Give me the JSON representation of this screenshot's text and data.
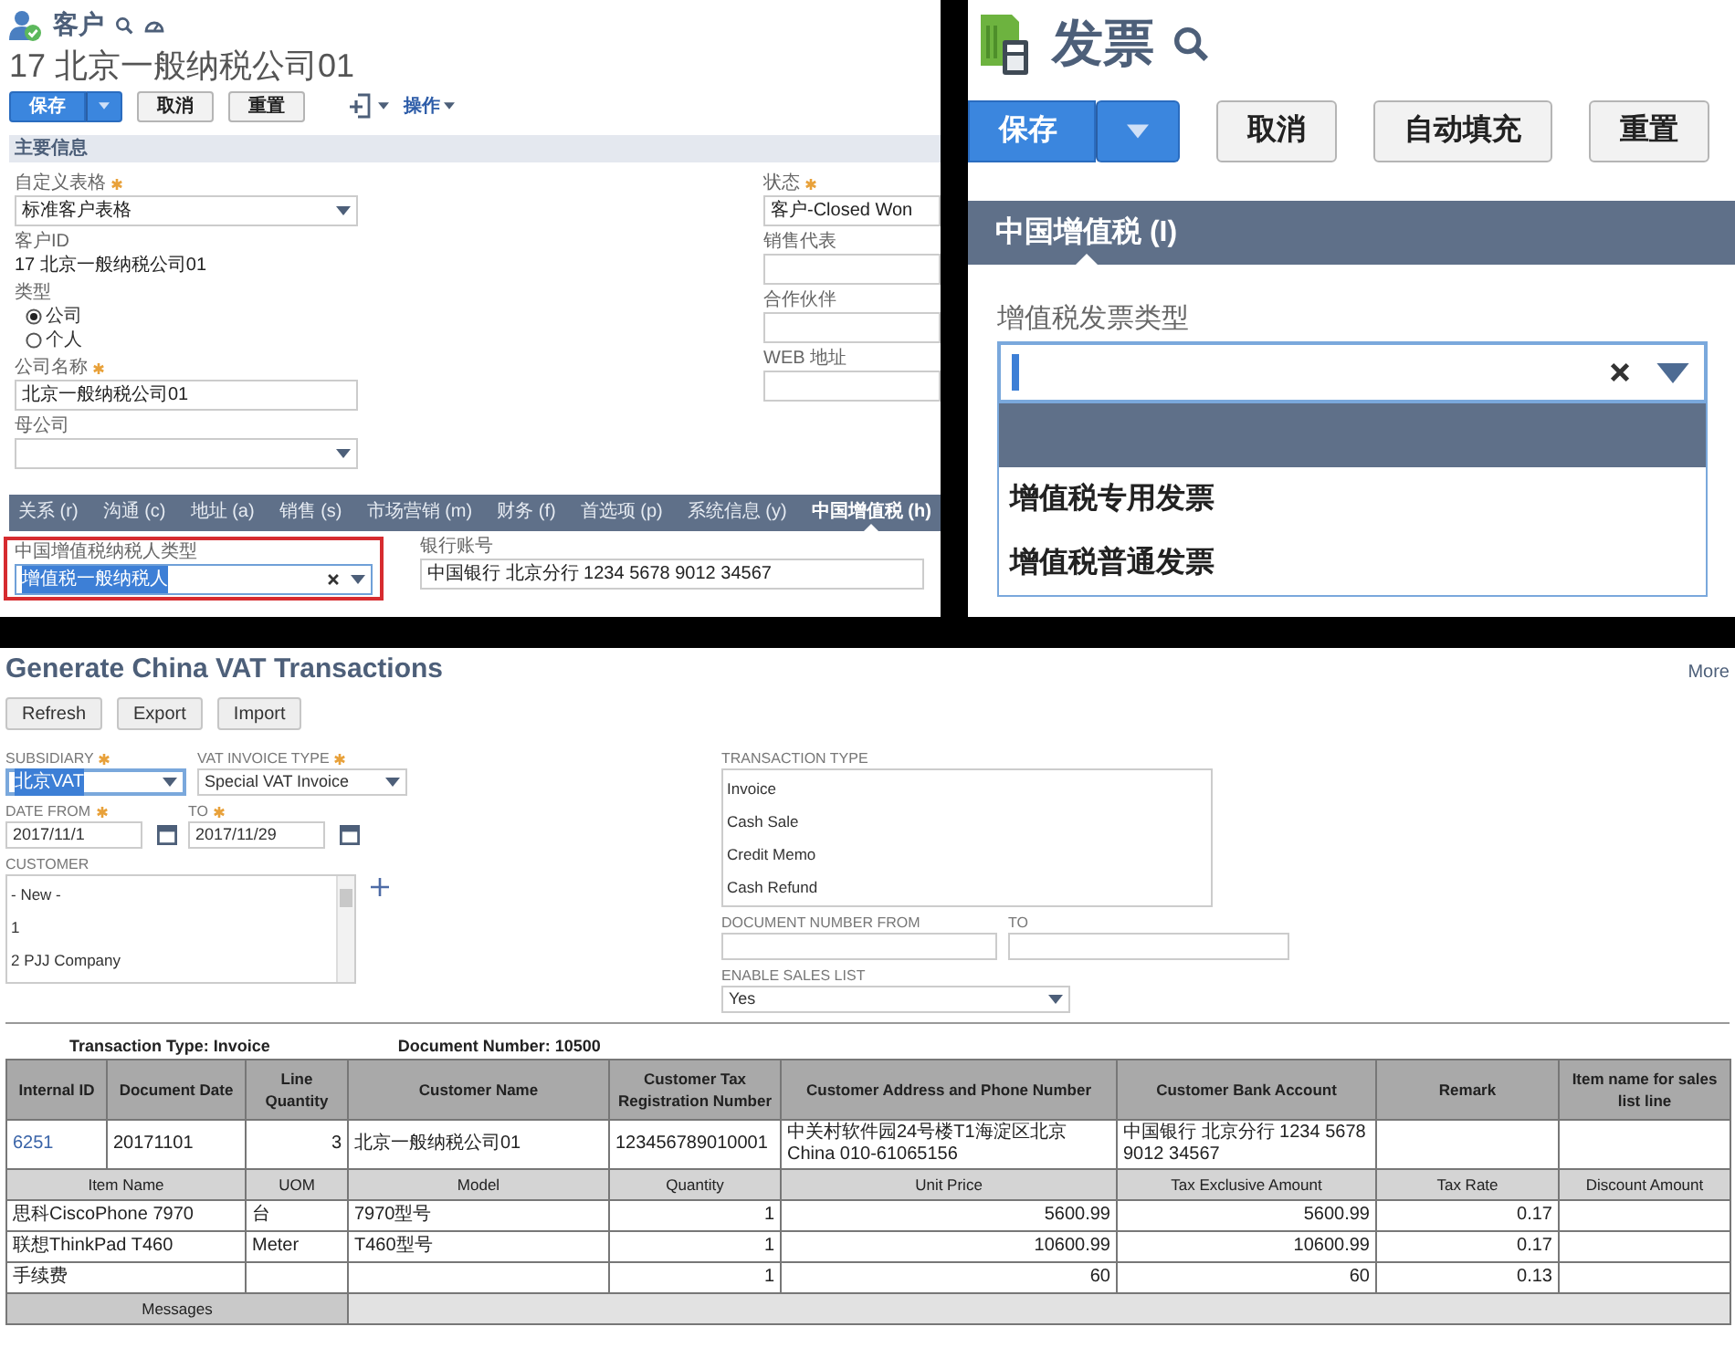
{
  "customer_form": {
    "title": "客户",
    "record_name": "17 北京一般纳税公司01",
    "buttons": [
      {
        "label": "保存",
        "kind": "split"
      },
      {
        "label": "取消",
        "kind": "plain"
      },
      {
        "label": "重置",
        "kind": "plain"
      }
    ],
    "actions_menu": "操作",
    "section": "主要信息",
    "left_fields": [
      {
        "kind": "select",
        "label": "自定义表格",
        "required": true,
        "value": "标准客户表格"
      },
      {
        "kind": "static",
        "label": "客户ID",
        "value": "17 北京一般纳税公司01"
      },
      {
        "kind": "radio",
        "label": "类型",
        "options": [
          {
            "label": "公司",
            "selected": true
          },
          {
            "label": "个人",
            "selected": false
          }
        ]
      },
      {
        "kind": "text",
        "label": "公司名称",
        "required": true,
        "value": "北京一般纳税公司01"
      },
      {
        "kind": "select",
        "label": "母公司"
      }
    ],
    "right_fields": [
      {
        "kind": "text",
        "label": "状态",
        "required": true,
        "value": "客户-Closed Won"
      },
      {
        "kind": "text",
        "label": "销售代表"
      },
      {
        "kind": "text",
        "label": "合作伙伴"
      },
      {
        "kind": "text",
        "label": "WEB 地址"
      }
    ],
    "tabs": [
      {
        "label": "关系 (r)",
        "selected": false
      },
      {
        "label": "沟通 (c)",
        "selected": false
      },
      {
        "label": "地址 (a)",
        "selected": false
      },
      {
        "label": "销售 (s)",
        "selected": false
      },
      {
        "label": "市场营销 (m)",
        "selected": false
      },
      {
        "label": "财务 (f)",
        "selected": false
      },
      {
        "label": "首选项 (p)",
        "selected": false
      },
      {
        "label": "系统信息 (y)",
        "selected": false
      },
      {
        "label": "中国增值税 (h)",
        "selected": true
      }
    ],
    "tab_fields": [
      {
        "kind": "combo",
        "label": "中国增值税纳税人类型",
        "value": "增值税一般纳税人",
        "focused": true,
        "highlighted": true
      },
      {
        "kind": "text",
        "label": "银行账号",
        "value": "中国银行 北京分行 1234 5678 9012 34567"
      }
    ]
  },
  "invoice_form": {
    "title": "发票",
    "buttons": [
      {
        "label": "保存",
        "kind": "split"
      },
      {
        "label": "取消",
        "kind": "plain"
      },
      {
        "label": "自动填充",
        "kind": "plain"
      },
      {
        "label": "重置",
        "kind": "plain"
      }
    ],
    "tabs": [
      {
        "label": "中国增值税 (I)",
        "selected": true
      }
    ],
    "field": {
      "label": "增值税发票类型",
      "expanded": true,
      "blank_option_highlighted": true,
      "options": [
        {
          "label": "增值税专用发票",
          "selected": false
        },
        {
          "label": "增值税普通发票",
          "selected": false
        }
      ]
    }
  },
  "vat_page": {
    "title": "Generate China VAT Transactions",
    "more_link": "More",
    "buttons": [
      "Refresh",
      "Export",
      "Import"
    ],
    "subsidiary": {
      "label": "SUBSIDIARY",
      "required": true,
      "value": "北京VAT",
      "focused": true
    },
    "vat_invoice_type": {
      "label": "VAT INVOICE TYPE",
      "required": true,
      "value": "Special VAT Invoice"
    },
    "date_from": {
      "label": "DATE FROM",
      "required": true,
      "value": "2017/11/1"
    },
    "date_to": {
      "label": "TO",
      "required": true,
      "value": "2017/11/29"
    },
    "customer": {
      "label": "CUSTOMER",
      "options": [
        "- New -",
        "1",
        "2 PJJ Company"
      ]
    },
    "transaction_type": {
      "label": "TRANSACTION TYPE",
      "options": [
        "Invoice",
        "Cash Sale",
        "Credit Memo",
        "Cash Refund"
      ]
    },
    "document_number_from": {
      "label": "DOCUMENT NUMBER FROM"
    },
    "document_number_to": {
      "label": "TO"
    },
    "enable_sales_list": {
      "label": "ENABLE SALES LIST",
      "value": "Yes"
    }
  },
  "report": {
    "transaction_type": "Transaction Type: Invoice",
    "document_number": "Document Number: 10500",
    "columns": [
      {
        "label": "Internal ID",
        "kind": "link"
      },
      {
        "label": "Document Date"
      },
      {
        "label": "Line Quantity"
      },
      {
        "label": "Customer Name"
      },
      {
        "label": "Customer Tax Registration Number"
      },
      {
        "label": "Customer Address and Phone Number"
      },
      {
        "label": "Customer Bank Account"
      },
      {
        "label": "Remark"
      },
      {
        "label": "Item name for sales list line"
      }
    ],
    "rows": [
      [
        "6251",
        "20171101",
        "3",
        "北京一般纳税公司01",
        "123456789010001",
        "中关村软件园24号楼T1海淀区北京 China 010-61065156",
        "中国银行 北京分行 1234 5678 9012 34567",
        null,
        null
      ]
    ],
    "item_columns": [
      {
        "label": "Item Name"
      },
      {
        "label": "UOM"
      },
      {
        "label": "Model"
      },
      {
        "label": "Quantity"
      },
      {
        "label": "Unit Price"
      },
      {
        "label": "Tax Exclusive Amount"
      },
      {
        "label": "Tax Rate"
      },
      {
        "label": "Discount Amount"
      }
    ],
    "item_rows": [
      [
        "思科CiscoPhone 7970",
        "台",
        "7970型号",
        "1",
        "5600.99",
        "5600.99",
        "0.17",
        null
      ],
      [
        "联想ThinkPad T460",
        "Meter",
        "T460型号",
        "1",
        "10600.99",
        "10600.99",
        "0.17",
        null
      ],
      [
        "手续费",
        null,
        null,
        "1",
        "60",
        "60",
        "0.13",
        null
      ]
    ],
    "messages_label": "Messages"
  }
}
